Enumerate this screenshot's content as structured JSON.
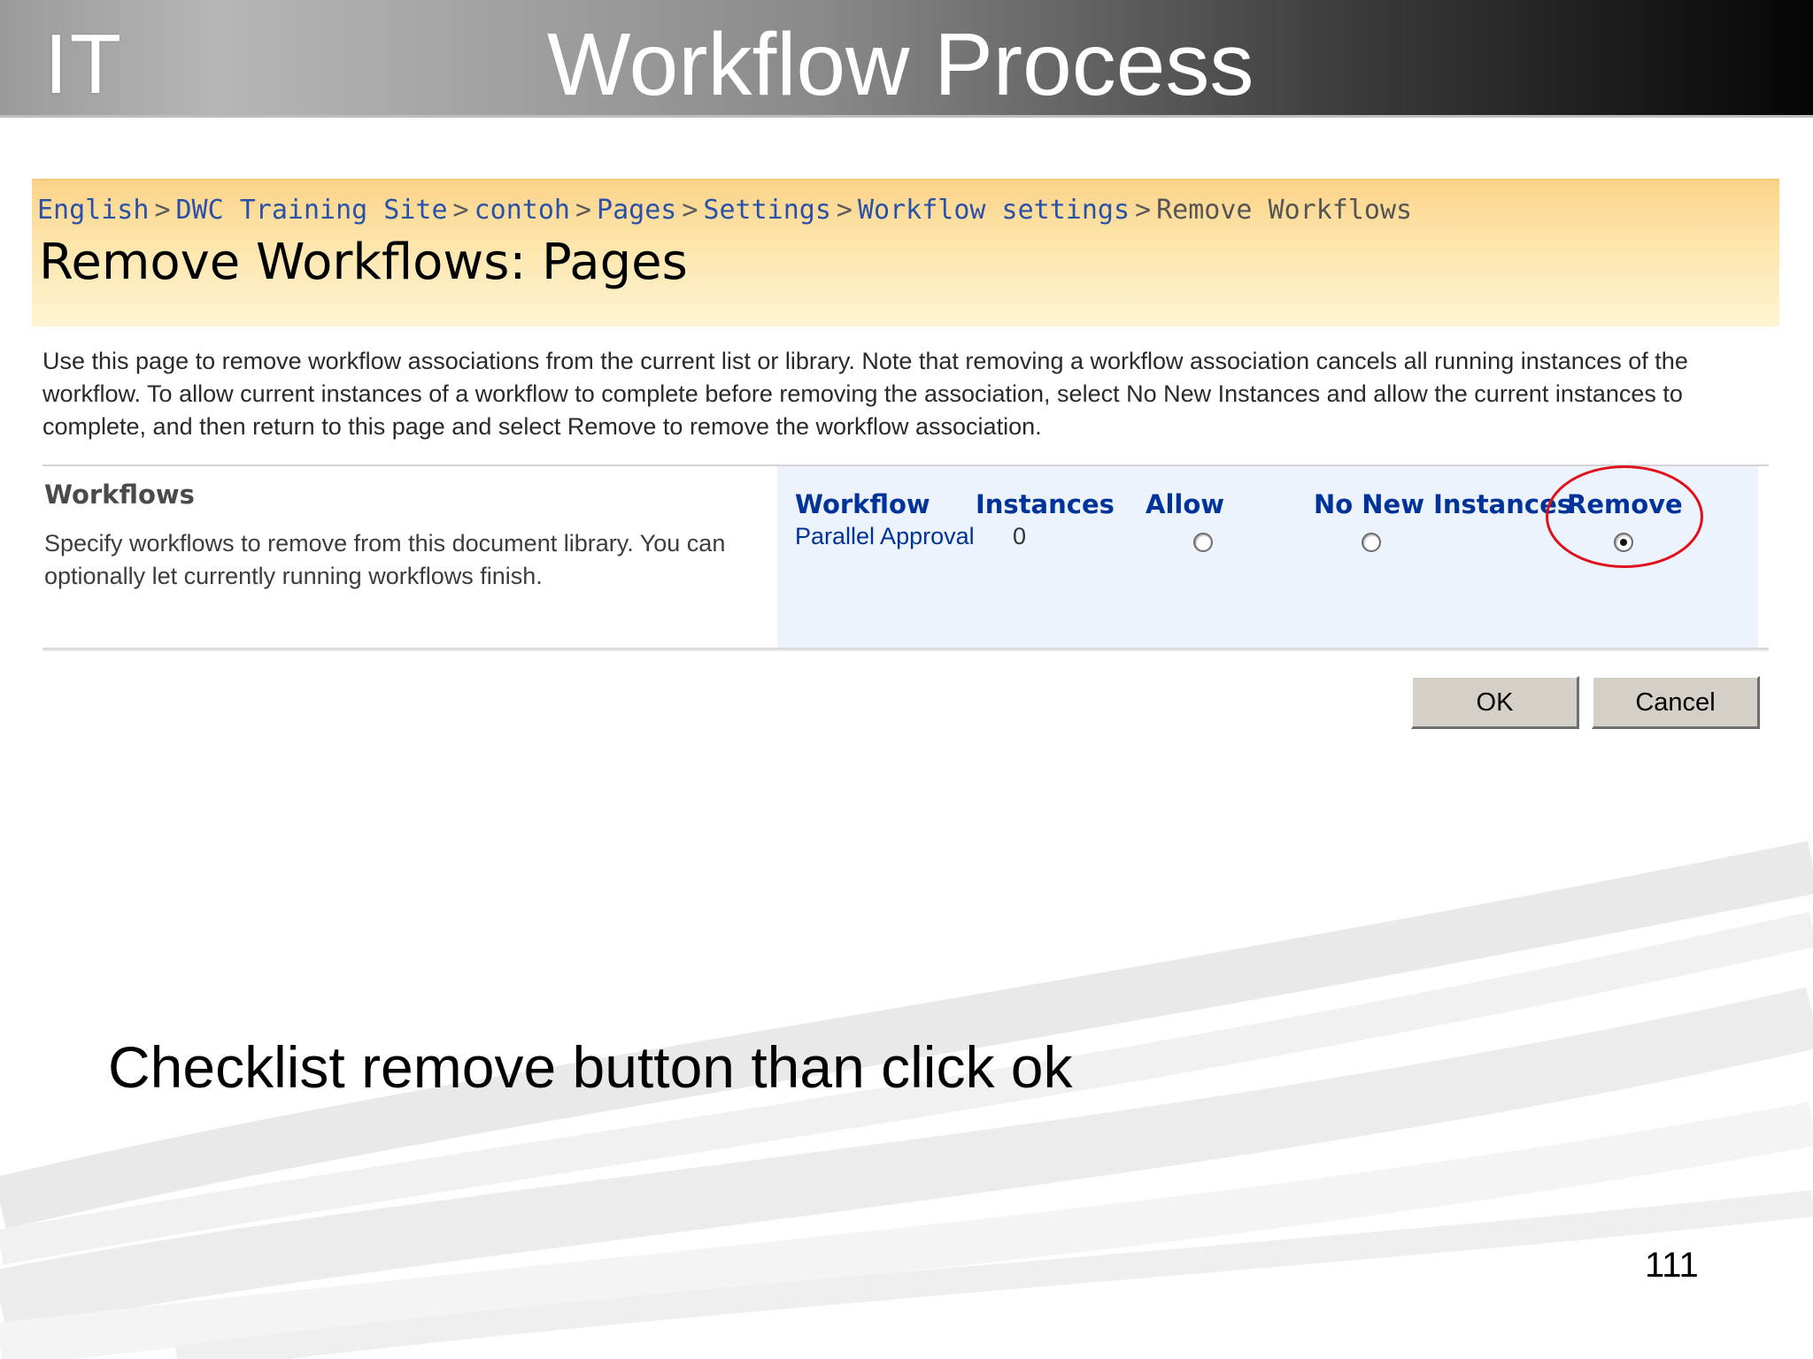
{
  "slide": {
    "logo": "IT",
    "title": "Workflow Process",
    "instruction": "Checklist remove button than click ok",
    "page_number": "111"
  },
  "screen": {
    "breadcrumb": {
      "links": [
        "English",
        "DWC Training Site",
        "contoh",
        "Pages",
        "Settings",
        "Workflow settings"
      ],
      "separator": ">",
      "current": "Remove Workflows"
    },
    "page_title": "Remove Workflows: Pages",
    "description": "Use this page to remove workflow associations from the current list or library. Note that removing a workflow association cancels all running instances of the workflow. To allow current instances of a workflow to complete before removing the association, select No New Instances and allow the current instances to complete, and then return to this page and select Remove to remove the workflow association.",
    "section": {
      "title": "Workflows",
      "description": "Specify workflows to remove from this document library. You can optionally let currently running workflows finish."
    },
    "table": {
      "columns": [
        "Workflow",
        "Instances",
        "Allow",
        "No New Instances",
        "Remove"
      ],
      "rows": [
        {
          "workflow": "Parallel Approval",
          "instances": "0",
          "selected": "Remove"
        }
      ]
    },
    "buttons": {
      "ok": "OK",
      "cancel": "Cancel"
    }
  },
  "colors": {
    "link": "#2a51a8",
    "column_header": "#003399",
    "title_band": "#fde6ad",
    "highlight": "#e0101a"
  }
}
